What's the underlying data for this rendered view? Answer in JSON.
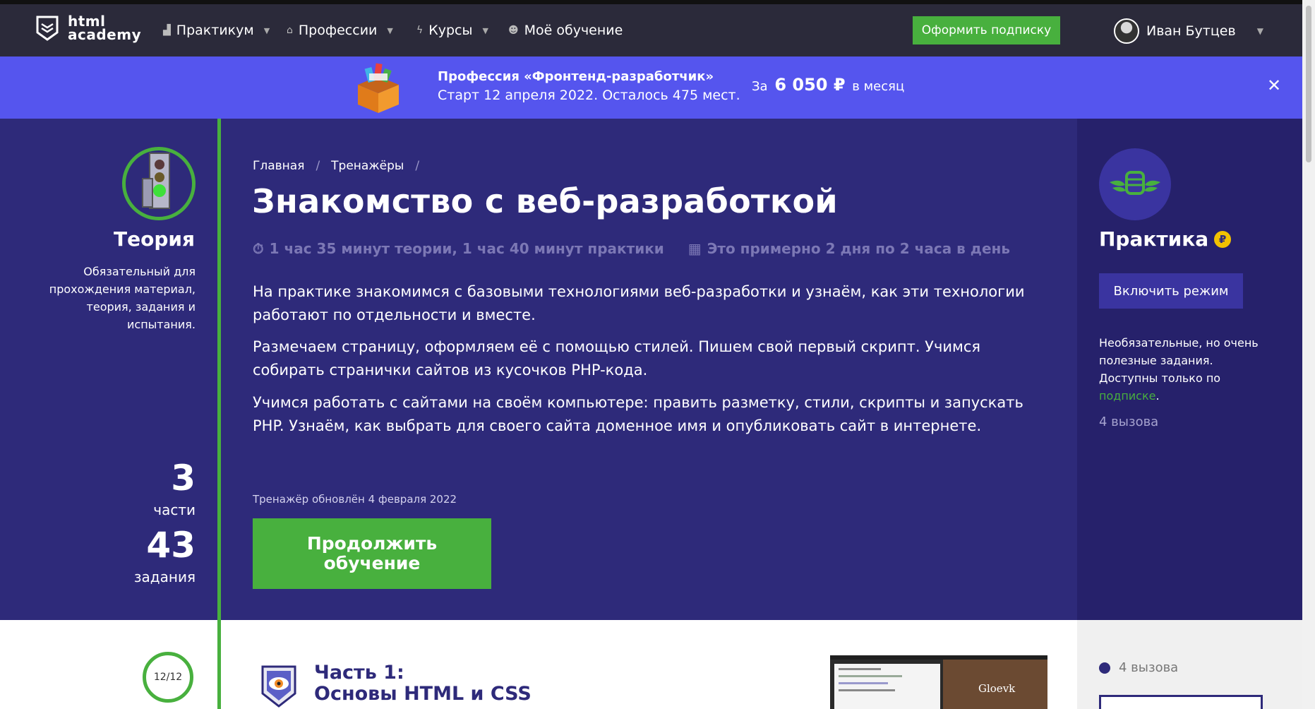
{
  "nav": {
    "logo_line1": "html",
    "logo_line2": "academy",
    "items": [
      {
        "label": "Практикум",
        "icon": "chart-icon"
      },
      {
        "label": "Профессии",
        "icon": "graduation-icon"
      },
      {
        "label": "Курсы",
        "icon": "lightning-icon"
      },
      {
        "label": "Моё обучение",
        "icon": "people-icon"
      }
    ],
    "subscribe_label": "Оформить подписку",
    "user_name": "Иван Бутцев"
  },
  "promo": {
    "title": "Профессия «Фронтенд-разработчик»",
    "subtitle": "Старт 12 апреля 2022. Осталось 475 мест.",
    "price_prefix": "За",
    "price_value": "6 050 ₽",
    "price_suffix": "в месяц",
    "close_glyph": "✕"
  },
  "theory": {
    "title": "Теория",
    "description": "Обязательный для прохождения материал, теория, задания и испытания.",
    "parts_count": "3",
    "parts_label": "части",
    "tasks_count": "43",
    "tasks_label": "задания"
  },
  "breadcrumb": {
    "home": "Главная",
    "section": "Тренажёры",
    "separator": "/"
  },
  "course": {
    "title": "Знакомство с веб-разработкой",
    "duration": "1 час 35 минут теории, 1 час 40 минут практики",
    "schedule": "Это примерно 2 дня по 2 часа в день",
    "paragraphs": [
      "На практике знакомимся с базовыми технологиями веб-разработки и узнаём, как эти технологии работают по отдельности и вместе.",
      "Размечаем страницу, оформляем её с помощью стилей. Пишем свой первый скрипт. Учимся собирать странички сайтов из кусочков PHP-кода.",
      "Учимся работать с сайтами на своём компьютере: править разметку, стили, скрипты и запускать PHP. Узнаём, как выбрать для своего сайта доменное имя и опубликовать сайт в интернете."
    ],
    "updated": "Тренажёр обновлён 4 февраля 2022",
    "continue_label": "Продолжить обучение"
  },
  "practice": {
    "title": "Практика",
    "coin_glyph": "₽",
    "mode_label": "Включить режим",
    "desc_prefix": "Необязательные, но очень полезные задания. Доступны только по",
    "desc_link": "подписке",
    "desc_suffix": ".",
    "count": "4 вызова"
  },
  "part1": {
    "progress": "12/12",
    "line1": "Часть 1:",
    "line2": "Основы HTML и CSS",
    "preview_title": "Gloevk",
    "challenges": "4 вызова"
  },
  "colors": {
    "nav_bg": "#2b2a3a",
    "banner_bg": "#5555ee",
    "hero_bg": "#2e2a7a",
    "panel_bg": "#26216b",
    "accent_green": "#48b03e"
  }
}
